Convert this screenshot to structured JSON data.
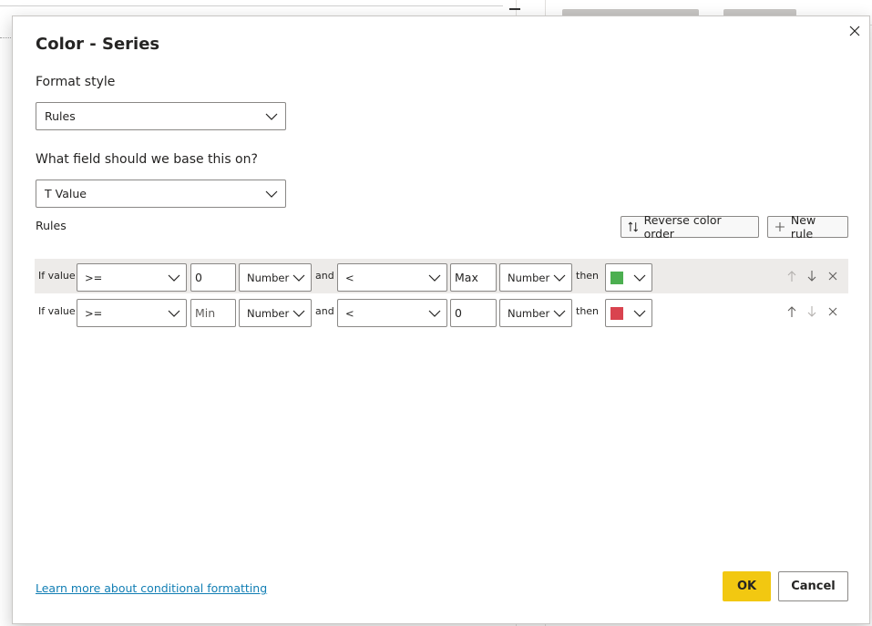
{
  "dialog": {
    "title": "Color - Series"
  },
  "format_style": {
    "label": "Format style",
    "value": "Rules"
  },
  "base_field": {
    "label": "What field should we base this on?",
    "value": "T Value"
  },
  "rules_section": {
    "label": "Rules",
    "reverse_label": "Reverse color order",
    "new_rule_label": "New rule"
  },
  "rules": [
    {
      "if_label": "If value",
      "op1": ">=",
      "val1": "0",
      "type1": "Number",
      "and_label": "and",
      "op2": "<",
      "val2": "Max",
      "type2": "Number",
      "then_label": "then",
      "color": "#4caf50"
    },
    {
      "if_label": "If value",
      "op1": ">=",
      "val1": "Min",
      "type1": "Number",
      "and_label": "and",
      "op2": "<",
      "val2": "0",
      "type2": "Number",
      "then_label": "then",
      "color": "#d9434f"
    }
  ],
  "footer": {
    "learn_more": "Learn more about conditional formatting",
    "ok_label": "OK",
    "cancel_label": "Cancel"
  },
  "colors": {
    "accent": "#f2c811",
    "link": "#117eb4"
  }
}
